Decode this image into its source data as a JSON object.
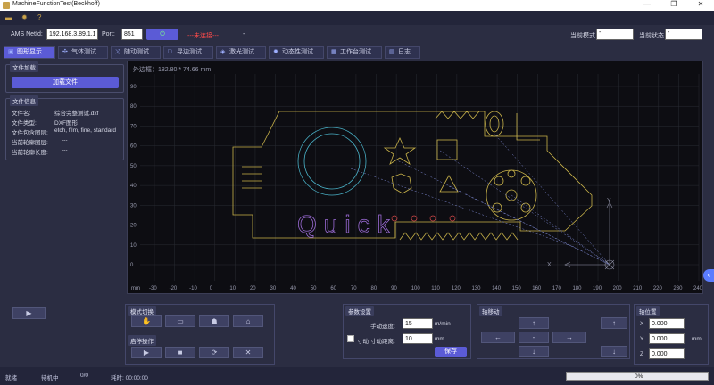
{
  "window": {
    "title": "MachineFunctionTest(Beckhoff)",
    "minimize": "—",
    "maximize": "❐",
    "close": "✕"
  },
  "toolbar": {
    "folder_icon": "folder-icon",
    "settings_icon": "gear-icon",
    "help_icon": "help-icon"
  },
  "connection": {
    "netid_label": "AMS NetId:",
    "netid_value": "192.168.3.89.1.1",
    "port_label": "Port:",
    "port_value": "851",
    "connect_icon": "plug-icon",
    "status_text": "---未连接---",
    "status_color": "#ff4a4a",
    "sep": "-",
    "mode_label": "当前模式",
    "mode_value": "-",
    "state_label": "当前状态",
    "state_value": "-"
  },
  "tabs": [
    {
      "label": "图形显示",
      "icon": "image-icon",
      "active": true
    },
    {
      "label": "气体测试",
      "icon": "fan-icon"
    },
    {
      "label": "随动测试",
      "icon": "shuffle-icon"
    },
    {
      "label": "寻边测试",
      "icon": "square-icon"
    },
    {
      "label": "激光测试",
      "icon": "target-icon"
    },
    {
      "label": "动态性测试",
      "icon": "gear-icon"
    },
    {
      "label": "工作台测试",
      "icon": "table-icon"
    },
    {
      "label": "日志",
      "icon": "log-icon"
    }
  ],
  "file_load": {
    "title": "文件加载",
    "button": "加载文件"
  },
  "file_info": {
    "title": "文件信息",
    "rows": [
      {
        "k": "文件名:",
        "v": "综合完整测试.dxf"
      },
      {
        "k": "文件类型:",
        "v": "DXF图形"
      },
      {
        "k": "文件包含图层:",
        "v": "etch, film, fine, standard"
      },
      {
        "k": "当前轮廓图层:",
        "v": "---"
      },
      {
        "k": "当前轮廓长度:",
        "v": "---"
      }
    ]
  },
  "canvas": {
    "outer_frame": "外边框：182.80 * 74.66 mm",
    "x_axis_unit": "mm",
    "x_ticks": [
      "-30",
      "-20",
      "-10",
      "0",
      "10",
      "20",
      "30",
      "40",
      "50",
      "60",
      "70",
      "80",
      "90",
      "100",
      "110",
      "120",
      "130",
      "140",
      "150",
      "160",
      "170",
      "180",
      "190",
      "200",
      "210",
      "220",
      "230",
      "240"
    ],
    "y_ticks": [
      "90",
      "80",
      "70",
      "60",
      "50",
      "40",
      "30",
      "20",
      "10",
      "0"
    ],
    "axis_x_label": "X",
    "axis_y_label": "Y",
    "drawing_text": "Quick"
  },
  "bottom": {
    "play_icon": "play-icon",
    "mode_switch": {
      "title": "模式切换",
      "icons": [
        "hand-icon",
        "briefcase-icon",
        "robot-icon",
        "home-icon"
      ]
    },
    "start_stop": {
      "title": "启停操作",
      "icons": [
        "start-icon",
        "stop-icon",
        "reset-icon",
        "mute-icon"
      ]
    },
    "params": {
      "title": "参数设置",
      "manual_speed_label": "手动速度:",
      "manual_speed_value": "15",
      "speed_unit": "m/min",
      "jog_label": "寸动",
      "jog_dist_label": "寸动距离:",
      "jog_dist_value": "10",
      "dist_unit": "mm",
      "save": "保存"
    },
    "axis_move": {
      "title": "轴移动",
      "mid": "-"
    },
    "axis_pos": {
      "title": "轴位置",
      "axes": [
        {
          "n": "X",
          "v": "0.000"
        },
        {
          "n": "Y",
          "v": "0.000"
        },
        {
          "n": "Z",
          "v": "0.000"
        }
      ],
      "unit": "mm"
    }
  },
  "status": {
    "ready": "就绪",
    "machine": "待机中",
    "count": "0/0",
    "elapsed": "耗时: 00:00:00",
    "progress": "0%",
    "progress_value": 0
  }
}
